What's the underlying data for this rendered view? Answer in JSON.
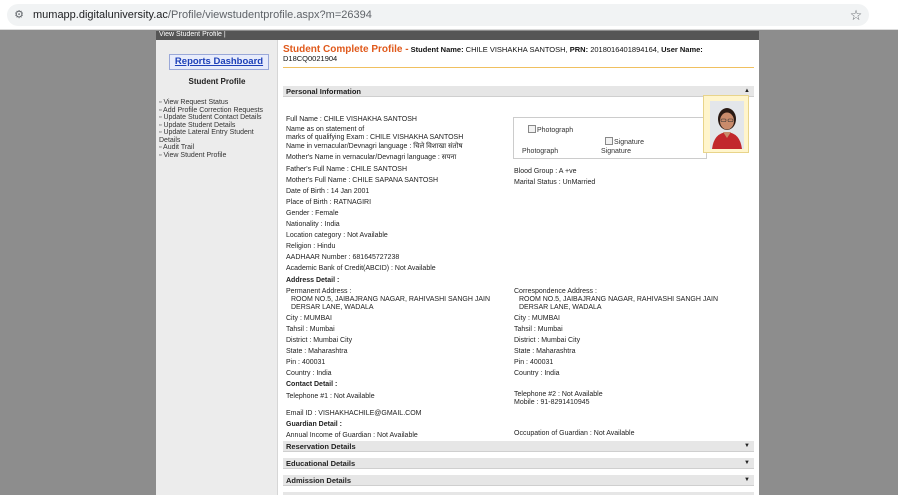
{
  "browser": {
    "url_host": "mumapp.digitaluniversity.ac",
    "url_path": "/Profile/viewstudentprofile.aspx?m=26394"
  },
  "topstrip": {
    "label": "View Student Profile |"
  },
  "sidebar": {
    "dashboard_label": "Reports Dashboard",
    "heading": "Student Profile",
    "links": [
      "View Request Status",
      "Add Profile Correction Requests",
      "Update Student Contact Details",
      "Update Student Details",
      "Update Lateral Entry Student Details",
      "Audit Trail",
      "View Student Profile"
    ]
  },
  "header": {
    "title": "Student Complete Profile -",
    "student_name_label": "Student Name:",
    "student_name": "CHILE VISHAKHA SANTOSH,",
    "prn_label": "PRN:",
    "prn": "2018016401894164,",
    "user_name_label": "User Name:",
    "user_name": "D18CQ0021904"
  },
  "sections": {
    "personal": "Personal Information",
    "reservation": "Reservation Details",
    "educational": "Educational Details",
    "admission": "Admission Details"
  },
  "personal": {
    "full_name": "Full Name : CHILE VISHAKHA SANTOSH",
    "name_statement_1": "Name as on statement of",
    "name_statement_2": "marks of qualifying Exam : CHILE VISHAKHA SANTOSH",
    "name_vernacular": "Name in vernacular/Devnagri language : चिले विशाखा संतोष",
    "mother_vernacular": "Mother's Name in vernacular/Devnagri language : सपना",
    "father": "Father's Full Name : CHILE SANTOSH",
    "mother": "Mother's Full Name : CHILE SAPANA SANTOSH",
    "dob": "Date of Birth : 14 Jan 2001",
    "pob": "Place of Birth : RATNAGIRI",
    "gender": "Gender : Female",
    "nationality": "Nationality : India",
    "location": "Location category : Not Available",
    "religion": "Religion : Hindu",
    "aadhaar": "AADHAAR Number : 681645727238",
    "abc": "Academic Bank of Credit(ABCID) : Not Available",
    "blood_group": "Blood Group : A +ve",
    "marital": "Marital Status : UnMarried",
    "photo_alt": "Photograph",
    "signature_alt": "Signature",
    "photo_caption": "Photograph",
    "signature_caption": "Signature"
  },
  "address": {
    "heading": "Address Detail :",
    "perm_label": "Permanent Address :",
    "perm_line1": "ROOM NO.5, JAIBAJRANG NAGAR, RAHIVASHI SANGH JAIN",
    "perm_line2": "DERSAR LANE, WADALA",
    "perm_city": "City : MUMBAI",
    "perm_tahsil": "Tahsil : Mumbai",
    "perm_district": "District : Mumbai City",
    "perm_state": "State : Maharashtra",
    "perm_pin": "Pin : 400031",
    "perm_country": "Country : India",
    "corr_label": "Correspondence Address :",
    "corr_line1": "ROOM NO.5, JAIBAJRANG NAGAR, RAHIVASHI SANGH JAIN",
    "corr_line2": "DERSAR LANE, WADALA",
    "corr_city": "City : MUMBAI",
    "corr_tahsil": "Tahsil : Mumbai",
    "corr_district": "District : Mumbai City",
    "corr_state": "State : Maharashtra",
    "corr_pin": "Pin : 400031",
    "corr_country": "Country : India"
  },
  "contact": {
    "heading": "Contact Detail :",
    "tel1": "Telephone #1 : Not Available",
    "tel2": "Telephone #2 : Not Available",
    "mobile": "Mobile : 91-8291410945",
    "email": "Email ID : VISHAKHACHILE@GMAIL.COM"
  },
  "guardian": {
    "heading": "Guardian Detail :",
    "income": "Annual Income of Guardian : Not Available",
    "occupation": "Occupation of Guardian : Not Available"
  },
  "colors": {
    "title_orange": "#e05a1c",
    "link_blue": "#1d40b8",
    "section_gray": "#e6e6e6",
    "photo_frame": "#fff5cc"
  }
}
